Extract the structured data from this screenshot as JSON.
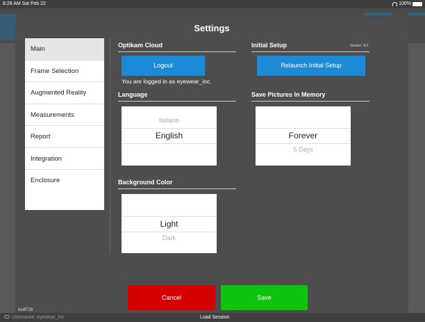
{
  "status": {
    "time": "8:28 AM  Sat Feb 22",
    "battery": "100%"
  },
  "modal": {
    "title": "Settings"
  },
  "sidebar": {
    "items": [
      {
        "label": "Main"
      },
      {
        "label": "Frame Selection"
      },
      {
        "label": "Augmented Reality"
      },
      {
        "label": "Measurements"
      },
      {
        "label": "Report"
      },
      {
        "label": "Integration"
      },
      {
        "label": "Enclosure"
      }
    ]
  },
  "cloud": {
    "title": "Optikam Cloud",
    "logout_label": "Logout",
    "logged_in_text": "You are logged in as eyewear_inc."
  },
  "initial_setup": {
    "title": "Initial Setup",
    "version": "Version: 8.0",
    "relaunch_label": "Relaunch Initial Setup"
  },
  "language": {
    "title": "Language",
    "options_visible": [
      "Italiano",
      "English"
    ],
    "selected": "English"
  },
  "save_pictures": {
    "title": "Save Pictures In Memory",
    "selected": "Forever",
    "next_option": "5 Days"
  },
  "background_color": {
    "title": "Background Color",
    "selected": "Light",
    "next_option": "Dark"
  },
  "actions": {
    "cancel_label": "Cancel",
    "save_label": "Save"
  },
  "footer": {
    "device_id": "bxdf726",
    "username": "Username: eyewear_inc",
    "load_session": "Load Session"
  },
  "colors": {
    "primary_blue": "#1c8ad6",
    "cancel_red": "#d40000",
    "save_green": "#0fc40f",
    "modal_bg": "#4d4d4d"
  }
}
